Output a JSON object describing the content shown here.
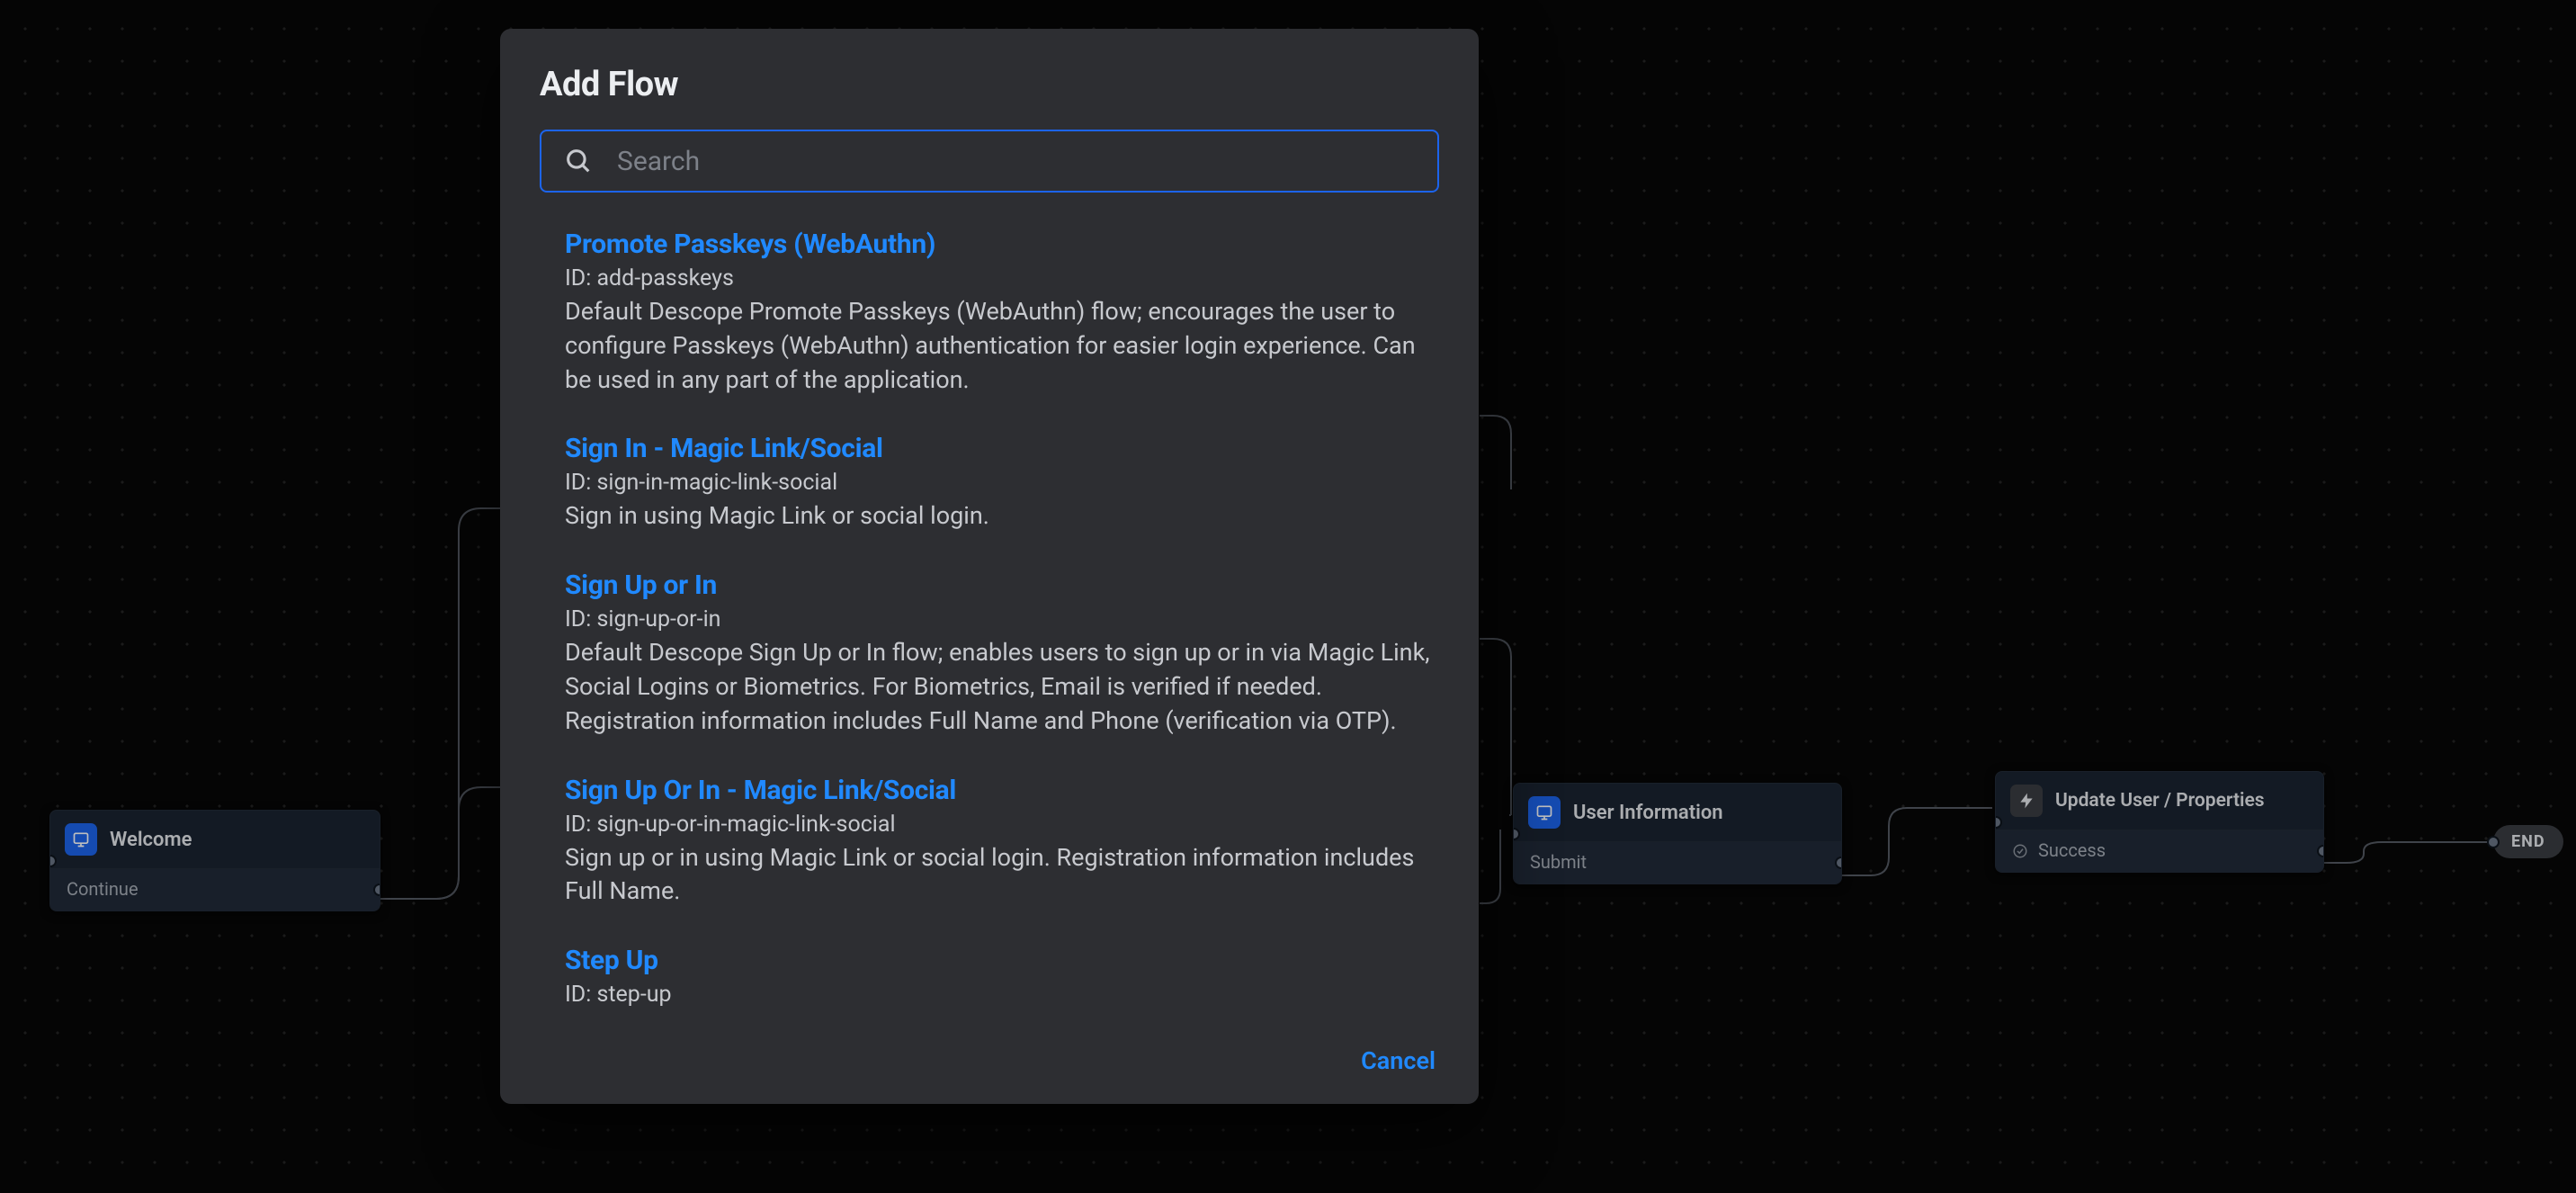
{
  "modal": {
    "title": "Add Flow",
    "search_placeholder": "Search",
    "cancel_label": "Cancel",
    "flows": [
      {
        "title": "Promote Passkeys (WebAuthn)",
        "id_label": "ID: add-passkeys",
        "desc": "Default Descope Promote Passkeys (WebAuthn) flow; encourages the user to configure Passkeys (WebAuthn) authentication for easier login experience. Can be used in any part of the application."
      },
      {
        "title": "Sign In - Magic Link/Social",
        "id_label": "ID: sign-in-magic-link-social",
        "desc": "Sign in using Magic Link or social login."
      },
      {
        "title": "Sign Up or In",
        "id_label": "ID: sign-up-or-in",
        "desc": "Default Descope Sign Up or In flow; enables users to sign up or in via Magic Link, Social Logins or Biometrics. For Biometrics, Email is verified if needed. Registration information includes Full Name and Phone (verification via OTP)."
      },
      {
        "title": "Sign Up Or In - Magic Link/Social",
        "id_label": "ID: sign-up-or-in-magic-link-social",
        "desc": "Sign up or in using Magic Link or social login. Registration information includes Full Name."
      },
      {
        "title": "Step Up",
        "id_label": "ID: step-up",
        "desc": ""
      }
    ]
  },
  "canvas": {
    "nodes": {
      "welcome": {
        "title": "Welcome",
        "action": "Continue"
      },
      "user_info": {
        "title": "User Information",
        "action": "Submit"
      },
      "update_user": {
        "title": "Update User / Properties",
        "action": "Success"
      }
    },
    "end_label": "END"
  },
  "colors": {
    "accent": "#1c64ed",
    "link": "#2089ff"
  }
}
